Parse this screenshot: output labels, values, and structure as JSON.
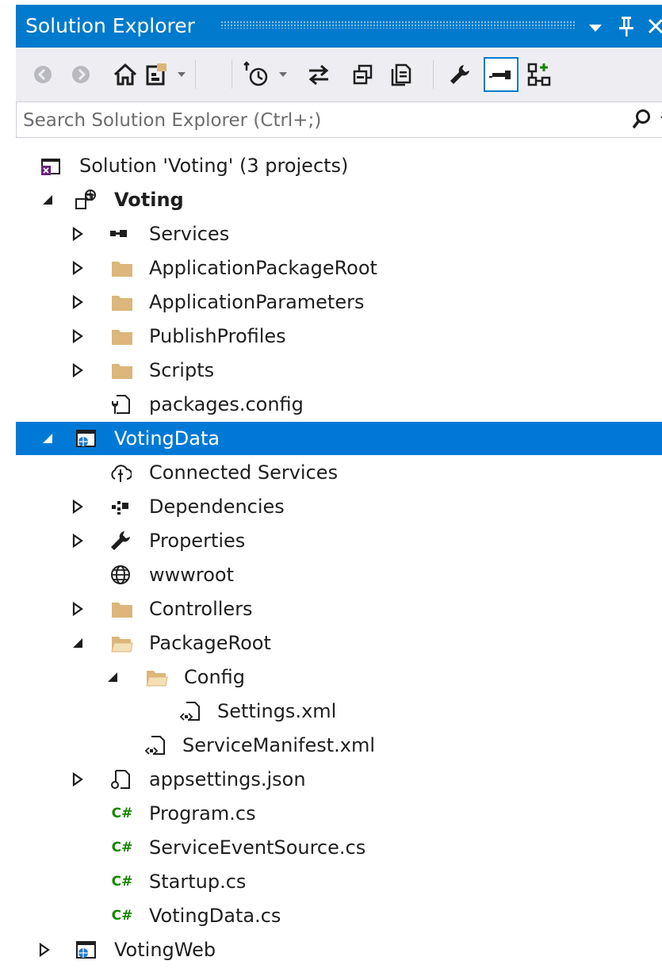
{
  "window": {
    "title": "Solution Explorer"
  },
  "search": {
    "placeholder": "Search Solution Explorer (Ctrl+;)"
  },
  "toolbar": {
    "buttons": [
      "back-icon",
      "forward-icon",
      "home-icon",
      "switch-views-icon",
      "pending-changes-filter-icon",
      "sync-with-active-document-icon",
      "collapse-all-icon",
      "show-all-files-icon",
      "properties-icon",
      "preview-selected-items-icon",
      "class-diagram-icon"
    ]
  },
  "tree": {
    "solution": "Solution 'Voting' (3 projects)",
    "voting": "Voting",
    "services": "Services",
    "app_package_root": "ApplicationPackageRoot",
    "app_parameters": "ApplicationParameters",
    "publish_profiles": "PublishProfiles",
    "scripts": "Scripts",
    "packages_config": "packages.config",
    "voting_data": "VotingData",
    "connected_services": "Connected Services",
    "dependencies": "Dependencies",
    "properties": "Properties",
    "wwwroot": "wwwroot",
    "controllers": "Controllers",
    "package_root": "PackageRoot",
    "config": "Config",
    "settings_xml": "Settings.xml",
    "service_manifest": "ServiceManifest.xml",
    "appsettings": "appsettings.json",
    "csharp_badge": "C#",
    "program_cs": "Program.cs",
    "service_event_source": "ServiceEventSource.cs",
    "startup_cs": "Startup.cs",
    "voting_data_cs": "VotingData.cs",
    "voting_web": "VotingWeb"
  },
  "colors": {
    "title_bar": "#007acc",
    "toolbar": "#eeeef2",
    "selection": "#0079d6",
    "folder": "#dcb67a",
    "csharp": "#178600"
  }
}
